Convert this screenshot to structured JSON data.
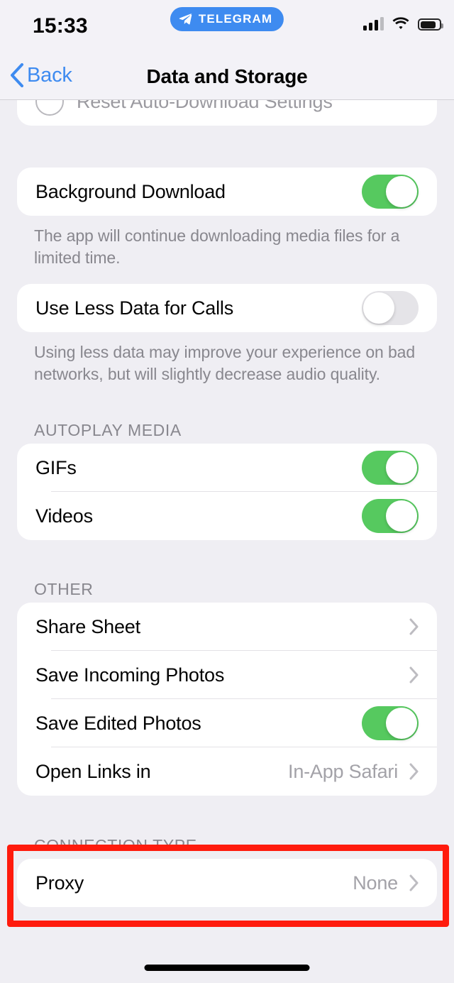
{
  "status_bar": {
    "time": "15:33",
    "app_badge": {
      "label": "TELEGRAM",
      "icon": "telegram-plane-icon",
      "color": "#3E8BF0"
    },
    "signal_icon": "cellular-signal-icon",
    "signal_bars_filled": 3,
    "signal_bars_total": 4,
    "wifi_icon": "wifi-icon",
    "battery_icon": "battery-icon",
    "battery_level_percent": 73
  },
  "nav_bar": {
    "back_label": "Back",
    "back_icon": "chevron-left-icon",
    "title": "Data and Storage",
    "accent_color": "#3E8BF0"
  },
  "sections": [
    {
      "name": "reset-partial",
      "rows": [
        {
          "label": "Reset Auto-Download Settings",
          "type": "action",
          "icon": "circle-icon",
          "state": "dimmed"
        }
      ]
    },
    {
      "name": "background-download",
      "rows": [
        {
          "label": "Background Download",
          "type": "toggle",
          "value": "on"
        }
      ],
      "footer": "The app will continue downloading media files for a limited time."
    },
    {
      "name": "use-less-data",
      "rows": [
        {
          "label": "Use Less Data for Calls",
          "type": "toggle",
          "value": "off"
        }
      ],
      "footer": "Using less data may improve your experience on bad networks, but will slightly decrease audio quality."
    },
    {
      "name": "autoplay-media",
      "header": "AUTOPLAY MEDIA",
      "rows": [
        {
          "label": "GIFs",
          "type": "toggle",
          "value": "on"
        },
        {
          "label": "Videos",
          "type": "toggle",
          "value": "on"
        }
      ]
    },
    {
      "name": "other",
      "header": "OTHER",
      "rows": [
        {
          "label": "Share Sheet",
          "type": "disclosure",
          "value": ""
        },
        {
          "label": "Save Incoming Photos",
          "type": "disclosure",
          "value": ""
        },
        {
          "label": "Save Edited Photos",
          "type": "toggle",
          "value": "on"
        },
        {
          "label": "Open Links in",
          "type": "disclosure",
          "value": "In-App Safari"
        }
      ]
    },
    {
      "name": "connection-type",
      "header": "CONNECTION TYPE",
      "rows": [
        {
          "label": "Proxy",
          "type": "disclosure",
          "value": "None"
        }
      ]
    }
  ],
  "annotation": {
    "type": "highlight-rectangle",
    "color": "#FF1B0D",
    "targets": "Proxy"
  },
  "colors": {
    "background": "#EFEEF3",
    "card": "#FFFFFF",
    "toggle_on": "#56C95F",
    "toggle_off": "#E5E4E8",
    "secondary_text": "#88878E",
    "value_text": "#A3A2A8"
  }
}
